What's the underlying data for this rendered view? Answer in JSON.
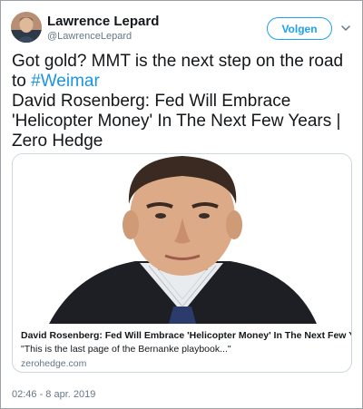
{
  "author": {
    "name": "Lawrence Lepard",
    "handle": "@LawrenceLepard"
  },
  "follow_button": {
    "label": "Volgen"
  },
  "more_menu": {
    "icon": "chevron-down-icon"
  },
  "tweet": {
    "line1": "Got gold?  MMT is the next step on the road",
    "line2_prefix": "to ",
    "hashtag": "#Weimar",
    "line3": "David Rosenberg: Fed Will Embrace",
    "line4": "'Helicopter Money' In The Next Few Years |",
    "line5": "Zero Hedge"
  },
  "card": {
    "title": "David Rosenberg: Fed Will Embrace 'Helicopter Money' In The Next Few Years",
    "description": "\"This is the last page of the Bernanke playbook...\"",
    "domain": "zerohedge.com"
  },
  "timestamp": "02:46 - 8 apr. 2019",
  "colors": {
    "accent": "#1da1f2",
    "hashtag": "#1b95e0",
    "secondary_text": "#657786",
    "border": "#ccd6dd"
  }
}
